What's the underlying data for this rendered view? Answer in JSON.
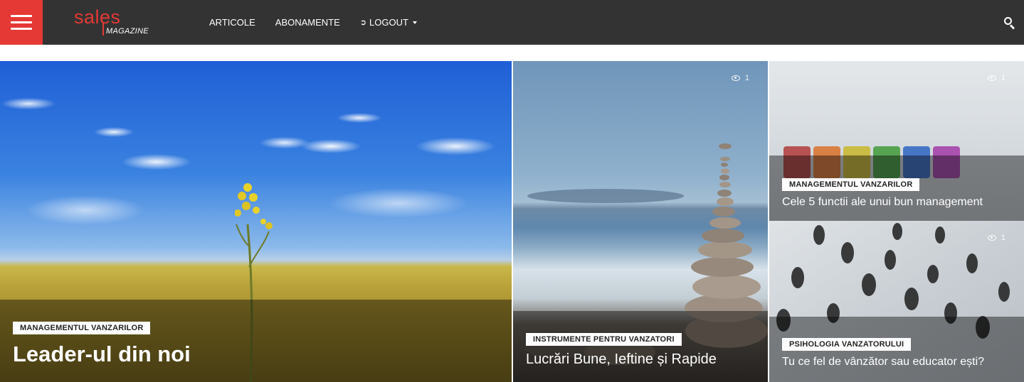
{
  "header": {
    "logo": {
      "word1": "sales",
      "word2": "MAGAZINE"
    },
    "nav": [
      {
        "label": "ARTICOLE"
      },
      {
        "label": "ABONAMENTE"
      },
      {
        "label": "LOGOUT"
      }
    ],
    "colors": {
      "bar": "#333333",
      "menu_button": "#e53935",
      "logo_red": "#e53935"
    }
  },
  "cards": [
    {
      "category": "MANAGEMENTUL VANZARILOR",
      "title": "Leader-ul din noi"
    },
    {
      "category": "INSTRUMENTE PENTRU VANZATORI",
      "title": "Lucrări Bune, Ieftine și Rapide",
      "views": "1"
    },
    {
      "category": "MANAGEMENTUL VANZARILOR",
      "title": "Cele 5 functii ale unui bun management",
      "views": "1"
    },
    {
      "category": "PSIHOLOGIA VANZATORULUI",
      "title": "Tu ce fel de vânzător sau educator ești?",
      "views": "1"
    }
  ]
}
